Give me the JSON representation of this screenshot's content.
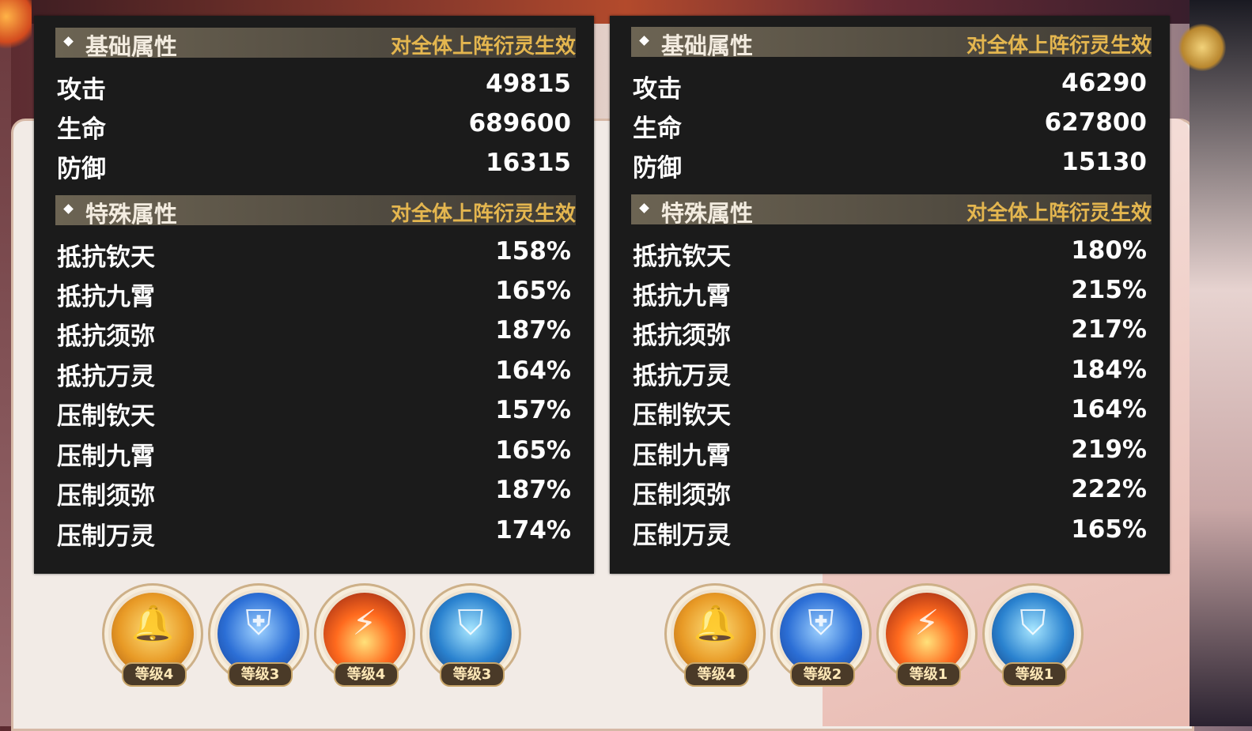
{
  "left_panel": {
    "basic_header": {
      "title": "基础属性",
      "effect": "对全体上阵衍灵生效"
    },
    "basic_stats": [
      {
        "name": "攻击",
        "value": "49815"
      },
      {
        "name": "生命",
        "value": "689600"
      },
      {
        "name": "防御",
        "value": "16315"
      }
    ],
    "special_header": {
      "title": "特殊属性",
      "effect": "对全体上阵衍灵生效"
    },
    "special_stats": [
      {
        "name": "抵抗钦天",
        "value": "158%"
      },
      {
        "name": "抵抗九霄",
        "value": "165%"
      },
      {
        "name": "抵抗须弥",
        "value": "187%"
      },
      {
        "name": "抵抗万灵",
        "value": "164%"
      },
      {
        "name": "压制钦天",
        "value": "157%"
      },
      {
        "name": "压制九霄",
        "value": "165%"
      },
      {
        "name": "压制须弥",
        "value": "187%"
      },
      {
        "name": "压制万灵",
        "value": "174%"
      }
    ],
    "skills": [
      {
        "icon": "golden-bells-icon",
        "level": "等级4"
      },
      {
        "icon": "blue-shield-icon",
        "level": "等级3"
      },
      {
        "icon": "fire-lightning-icon",
        "level": "等级4"
      },
      {
        "icon": "ice-shields-icon",
        "level": "等级3"
      }
    ]
  },
  "right_panel": {
    "basic_header": {
      "title": "基础属性",
      "effect": "对全体上阵衍灵生效"
    },
    "basic_stats": [
      {
        "name": "攻击",
        "value": "46290"
      },
      {
        "name": "生命",
        "value": "627800"
      },
      {
        "name": "防御",
        "value": "15130"
      }
    ],
    "special_header": {
      "title": "特殊属性",
      "effect": "对全体上阵衍灵生效"
    },
    "special_stats": [
      {
        "name": "抵抗钦天",
        "value": "180%"
      },
      {
        "name": "抵抗九霄",
        "value": "215%"
      },
      {
        "name": "抵抗须弥",
        "value": "217%"
      },
      {
        "name": "抵抗万灵",
        "value": "184%"
      },
      {
        "name": "压制钦天",
        "value": "164%"
      },
      {
        "name": "压制九霄",
        "value": "219%"
      },
      {
        "name": "压制须弥",
        "value": "222%"
      },
      {
        "name": "压制万灵",
        "value": "165%"
      }
    ],
    "skills": [
      {
        "icon": "golden-bells-icon",
        "level": "等级4"
      },
      {
        "icon": "blue-shield-icon",
        "level": "等级2"
      },
      {
        "icon": "fire-lightning-icon",
        "level": "等级1"
      },
      {
        "icon": "ice-shields-icon",
        "level": "等级1"
      }
    ]
  },
  "colors": {
    "panel_bg": "#1b1b1b",
    "header_effect": "#e4b64f",
    "stat_text": "#ffffff"
  }
}
